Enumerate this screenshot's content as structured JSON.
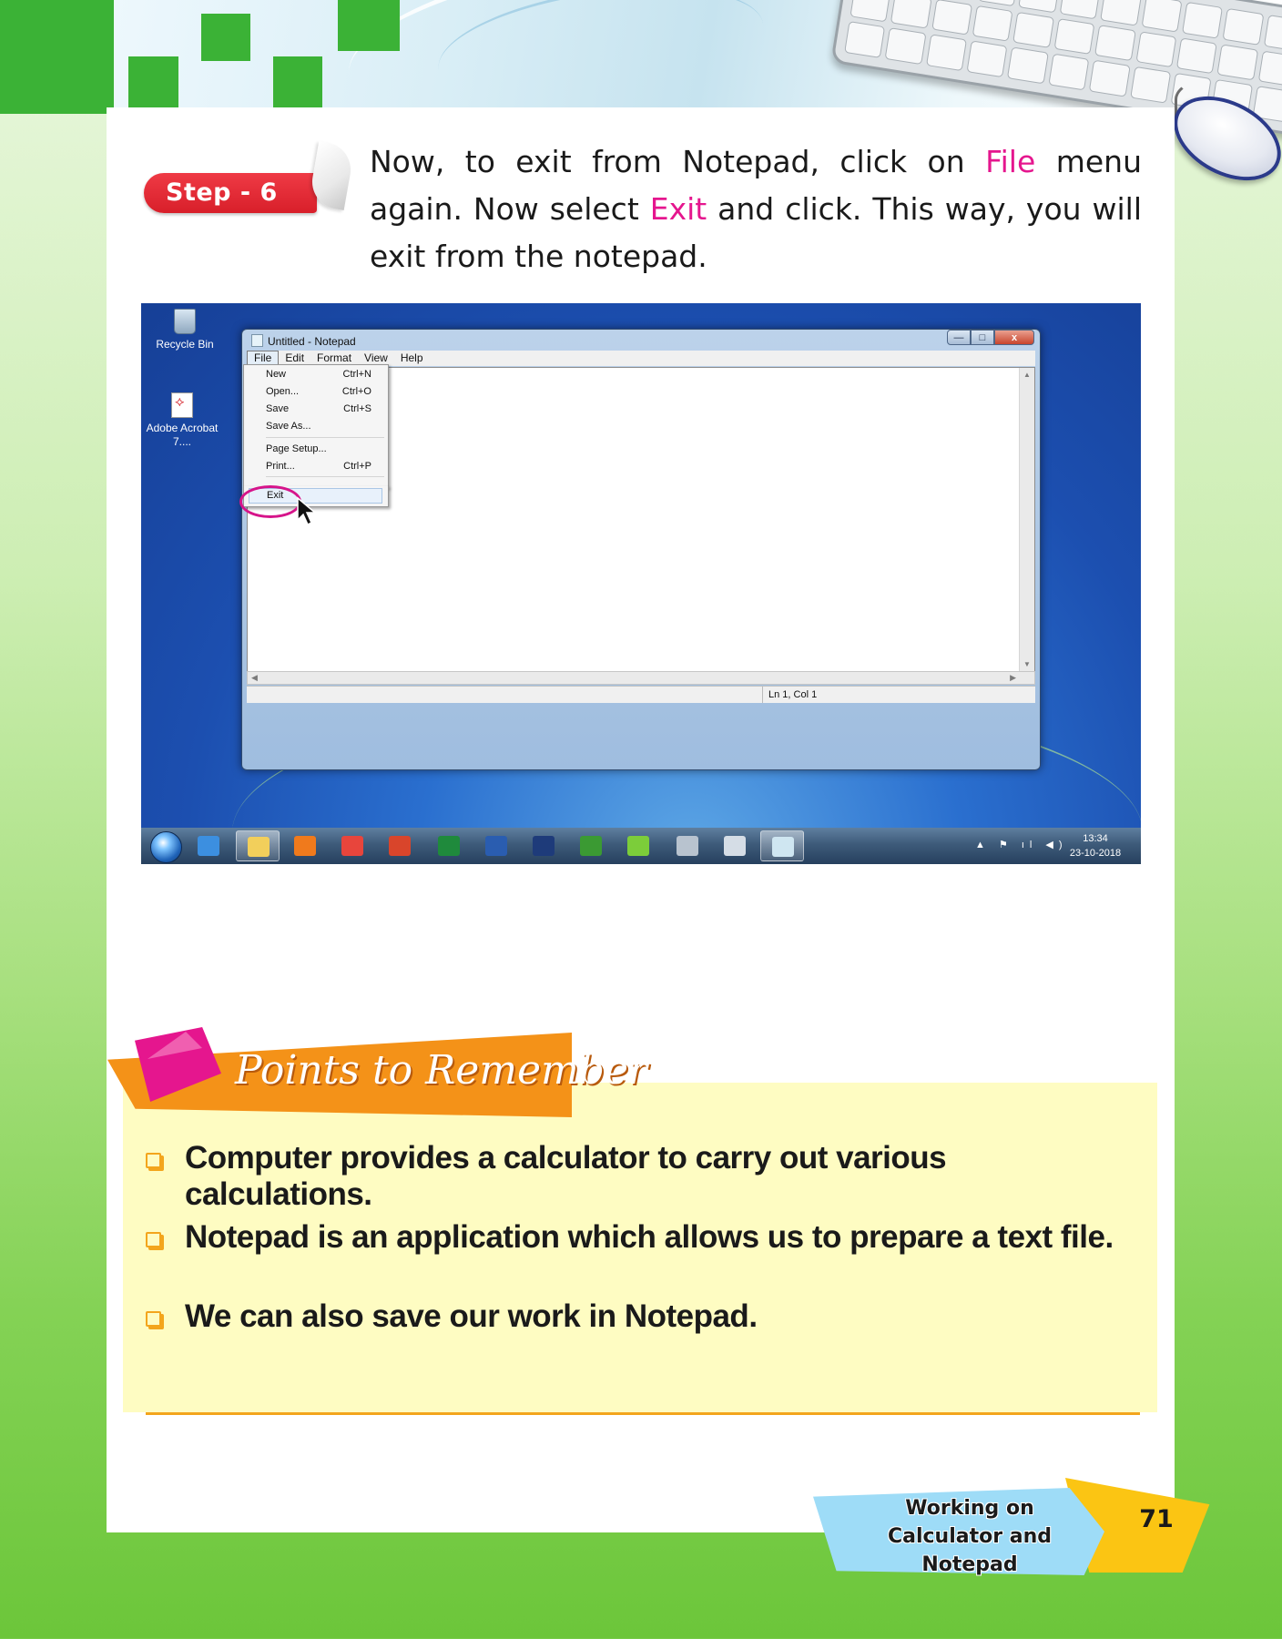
{
  "step": {
    "badge": "Step - 6",
    "text_parts": [
      "Now, to exit from Notepad, click on ",
      "File",
      " menu again. Now select ",
      "Exit",
      " and click. This way, you will exit from the notepad."
    ]
  },
  "screenshot": {
    "desktop_icons": [
      {
        "label": "Recycle Bin",
        "icon": "recycle-bin-icon"
      },
      {
        "label": "Adobe Acrobat 7....",
        "icon": "adobe-acrobat-icon"
      }
    ],
    "window": {
      "title": "Untitled - Notepad",
      "buttons": {
        "minimize": "—",
        "maximize": "□",
        "close": "x"
      },
      "menubar": [
        "File",
        "Edit",
        "Format",
        "View",
        "Help"
      ],
      "status": "Ln 1, Col 1"
    },
    "file_menu": [
      {
        "label": "New",
        "shortcut": "Ctrl+N"
      },
      {
        "label": "Open...",
        "shortcut": "Ctrl+O"
      },
      {
        "label": "Save",
        "shortcut": "Ctrl+S"
      },
      {
        "label": "Save As...",
        "shortcut": ""
      },
      {
        "label": "Page Setup...",
        "shortcut": ""
      },
      {
        "label": "Print...",
        "shortcut": "Ctrl+P"
      },
      {
        "label": "Exit",
        "shortcut": ""
      }
    ],
    "taskbar": {
      "apps": [
        {
          "name": "internet-explorer-icon",
          "color": "#3c8fe0"
        },
        {
          "name": "file-explorer-icon",
          "color": "#f2cf5b"
        },
        {
          "name": "media-player-icon",
          "color": "#f07a1c"
        },
        {
          "name": "chrome-icon",
          "color": "#e8453c"
        },
        {
          "name": "paper-plane-icon",
          "color": "#d9452b"
        },
        {
          "name": "excel-icon",
          "color": "#1f8a3c"
        },
        {
          "name": "word-icon",
          "color": "#2a5db0"
        },
        {
          "name": "photoshop-icon",
          "color": "#1e3b7a"
        },
        {
          "name": "coreldraw-icon",
          "color": "#3b9a33"
        },
        {
          "name": "green-app-icon",
          "color": "#7ccd3a"
        },
        {
          "name": "camera-icon",
          "color": "#b8c3cf"
        },
        {
          "name": "calculator-icon",
          "color": "#d5dde6"
        },
        {
          "name": "notepad-icon",
          "color": "#cfe6f1"
        }
      ],
      "time": "13:34",
      "date": "23-10-2018"
    }
  },
  "points": {
    "title": "Points to Remember",
    "items": [
      "Computer provides a calculator to carry out various calculations.",
      "Notepad is an application which allows us to prepare a text file.",
      "We can also save our work in Notepad."
    ]
  },
  "footer": {
    "chapter_line1": "Working on",
    "chapter_line2": "Calculator and Notepad",
    "page_number": "71"
  },
  "colors": {
    "highlight": "#e5168e",
    "step_badge": "#e0252f",
    "banner_orange": "#f49218",
    "points_bg": "#fefcc2"
  }
}
